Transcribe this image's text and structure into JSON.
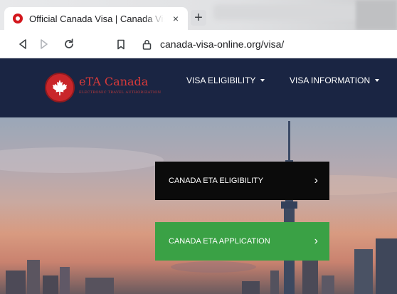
{
  "browser": {
    "tab": {
      "title": "Official Canada Visa | Canada Visa Online",
      "close_glyph": "×",
      "favicon": "canada-maple-favicon"
    },
    "new_tab_glyph": "+",
    "address_bar": {
      "url": "canada-visa-online.org/visa/",
      "lock_icon": "lock-icon"
    },
    "toolbar_icons": [
      "back-icon",
      "forward-icon",
      "reload-icon",
      "bookmark-icon"
    ]
  },
  "site": {
    "logo": {
      "title": "eTA Canada",
      "subtitle": "ELECTRONIC TRAVEL AUTHORIZATION",
      "emblem": "maple-leaf-icon"
    },
    "nav": [
      {
        "label": "VISA ELIGIBILITY",
        "dropdown": true
      },
      {
        "label": "VISA INFORMATION",
        "dropdown": true
      }
    ],
    "hero": {
      "buttons": [
        {
          "label": "CANADA ETA ELIGIBILITY",
          "chevron": "›",
          "color": "#0b0b0b"
        },
        {
          "label": "CANADA ETA APPLICATION",
          "chevron": "›",
          "color": "#3aa145"
        }
      ]
    }
  },
  "colors": {
    "navbar": "#1a2543",
    "brand_red": "#d83a3a",
    "cta_dark": "#0b0b0b",
    "cta_green": "#3aa145"
  }
}
